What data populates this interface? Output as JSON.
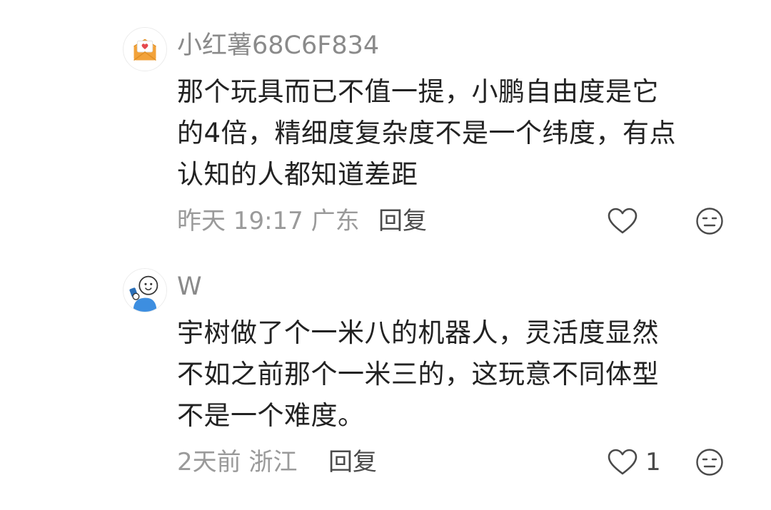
{
  "comments": [
    {
      "username": "小红薯68C6F834",
      "avatar_icon": "envelope-heart-icon",
      "lines": [
        "那个玩具而已不值一提，小鹏自由度是它",
        "的4倍，精细度复杂度不是一个纬度，有点",
        "认知的人都知道差距"
      ],
      "meta": "昨天 19:17 广东",
      "reply_label": "回复",
      "like_count": "",
      "like_icon": "heart-outline-icon",
      "dislike_icon": "neutral-face-icon"
    },
    {
      "username": "W",
      "avatar_icon": "cartoon-character-icon",
      "lines": [
        "宇树做了个一米八的机器人，灵活度显然",
        "不如之前那个一米三的，这玩意不同体型",
        "不是一个难度。"
      ],
      "meta": "2天前 浙江",
      "reply_label": "回复",
      "like_count": "1",
      "like_icon": "heart-outline-icon",
      "dislike_icon": "neutral-face-icon"
    }
  ],
  "colors": {
    "username": "#8a8a8a",
    "content": "#222222",
    "meta": "#9a9a9a",
    "reply": "#4a4a4a",
    "envelope": "#f2a23a",
    "heart": "#e5484d",
    "character_shirt": "#3d8ee0"
  }
}
